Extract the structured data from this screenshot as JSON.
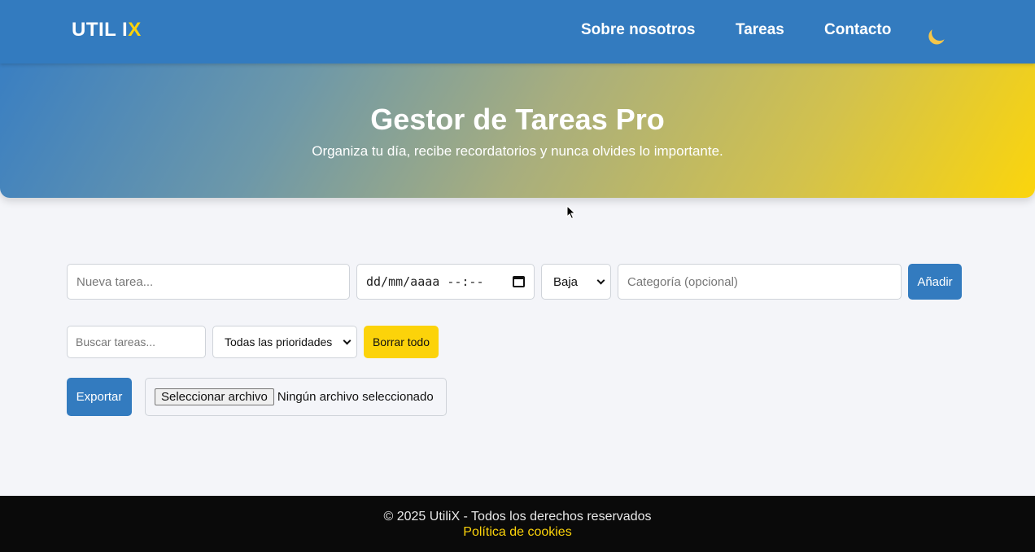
{
  "navbar": {
    "logo_main": "UTIL I",
    "logo_accent": "X",
    "links": {
      "about": "Sobre nosotros",
      "tasks": "Tareas",
      "contact": "Contacto"
    },
    "theme_icon": "moon-icon"
  },
  "hero": {
    "title": "Gestor de Tareas Pro",
    "subtitle": "Organiza tu día, recibe recordatorios y nunca olvides lo importante."
  },
  "task_form": {
    "task_placeholder": "Nueva tarea...",
    "date_placeholder": "dd/mm/aaaa --:--",
    "priority_selected": "Baja",
    "category_placeholder": "Categoría (opcional)",
    "add_label": "Añadir"
  },
  "filters": {
    "search_placeholder": "Buscar tareas...",
    "priority_filter_selected": "Todas las prioridades",
    "clear_label": "Borrar todo"
  },
  "import_export": {
    "export_label": "Exportar",
    "file_button_label": "Seleccionar archivo",
    "file_status": "Ningún archivo seleccionado"
  },
  "footer": {
    "copyright": "© 2025 UtiliX - Todos los derechos reservados",
    "cookies_link": "Política de cookies"
  },
  "colors": {
    "primary": "#337bbf",
    "accent": "#fcd30a",
    "background": "#f4f5f9",
    "footer": "#0a0a0a"
  }
}
